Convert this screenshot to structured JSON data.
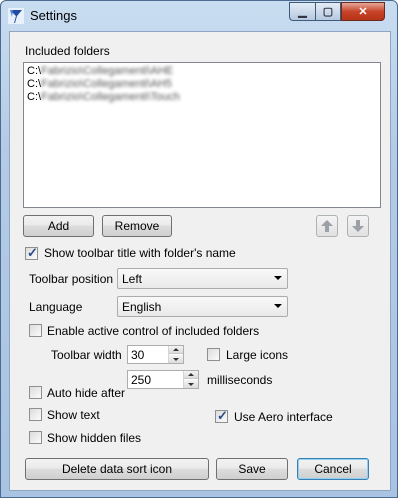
{
  "window": {
    "title": "Settings",
    "app_icon": "app-logo-icon",
    "controls": {
      "minimize_icon": "minimize-icon",
      "maximize_icon": "maximize-icon",
      "close_icon": "close-icon"
    }
  },
  "folders": {
    "label": "Included folders",
    "items": [
      {
        "prefix": "C:\\",
        "path": "Fabrizio\\Collegamenti\\AHE"
      },
      {
        "prefix": "C:\\",
        "path": "Fabrizio\\Collegamenti\\AH5"
      },
      {
        "prefix": "C:\\",
        "path": "Fabrizio\\Collegamenti\\Touch"
      }
    ],
    "add_label": "Add",
    "remove_label": "Remove",
    "move_up_icon": "arrow-up-icon",
    "move_down_icon": "arrow-down-icon"
  },
  "options": {
    "show_toolbar_title_label": "Show toolbar title with folder's name",
    "show_toolbar_title_checked": true,
    "toolbar_position_label": "Toolbar position",
    "toolbar_position_value": "Left",
    "language_label": "Language",
    "language_value": "English",
    "active_control_label": "Enable active control of included folders",
    "active_control_checked": false,
    "toolbar_width_label": "Toolbar width",
    "toolbar_width_value": "30",
    "large_icons_label": "Large icons",
    "large_icons_checked": false,
    "auto_hide_label": "Auto hide after",
    "auto_hide_checked": false,
    "auto_hide_value": "250",
    "milliseconds_label": "milliseconds",
    "show_text_label": "Show text",
    "show_text_checked": false,
    "use_aero_label": "Use Aero interface",
    "use_aero_checked": true,
    "show_hidden_label": "Show hidden files",
    "show_hidden_checked": false
  },
  "footer": {
    "delete_sort_label": "Delete data sort icon",
    "save_label": "Save",
    "cancel_label": "Cancel"
  }
}
